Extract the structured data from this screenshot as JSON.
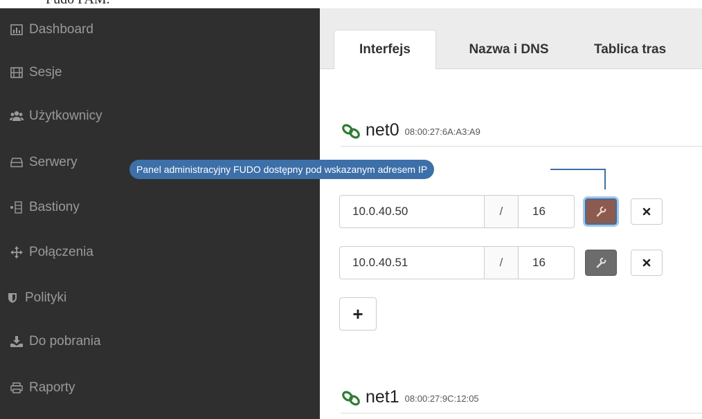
{
  "caption": "Fudo PAM.",
  "sidebar": {
    "items": [
      {
        "label": "Dashboard",
        "icon": "bar-chart-icon"
      },
      {
        "label": "Sesje",
        "icon": "film-icon"
      },
      {
        "label": "Użytkownicy",
        "icon": "users-icon"
      },
      {
        "label": "Serwery",
        "icon": "server-icon"
      },
      {
        "label": "Bastiony",
        "icon": "bastion-icon"
      },
      {
        "label": "Połączenia",
        "icon": "move-icon"
      },
      {
        "label": "Polityki",
        "icon": "shield-icon"
      },
      {
        "label": "Do pobrania",
        "icon": "download-icon"
      },
      {
        "label": "Raporty",
        "icon": "print-icon"
      }
    ]
  },
  "tabs": [
    {
      "label": "Interfejs",
      "active": true
    },
    {
      "label": "Nazwa i DNS",
      "active": false
    },
    {
      "label": "Tablica tras",
      "active": false
    }
  ],
  "interfaces": {
    "net0": {
      "name": "net0",
      "mac": "08:00:27:6A:A3:A9",
      "addresses": [
        {
          "ip": "10.0.40.50",
          "separator": "/",
          "mask": "16"
        },
        {
          "ip": "10.0.40.51",
          "separator": "/",
          "mask": "16"
        }
      ]
    },
    "net1": {
      "name": "net1",
      "mac": "08:00:27:9C:12:05"
    }
  },
  "callout": {
    "text": "Panel administracyjny FUDO dostępny pod wskazanym adresem IP"
  },
  "add_label": "+",
  "colors": {
    "sidebar_bg": "#2f2f2f",
    "sidebar_text": "#9a9a9a",
    "callout_bg": "#3d6fa8",
    "link_icon": "#2e7d32",
    "highlight_button": "#8c5a4e"
  }
}
